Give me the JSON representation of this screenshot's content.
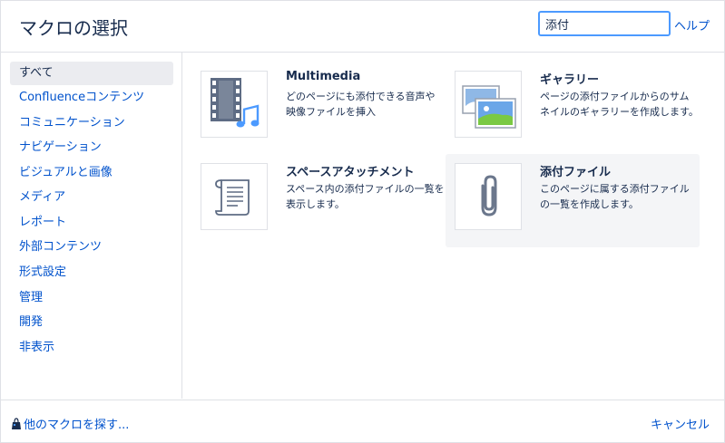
{
  "dialog": {
    "title": "マクロの選択"
  },
  "search": {
    "value": "添付"
  },
  "header": {
    "help_label": "ヘルプ"
  },
  "sidebar": {
    "items": [
      {
        "label": "すべて",
        "active": true
      },
      {
        "label": "Confluenceコンテンツ"
      },
      {
        "label": "コミュニケーション"
      },
      {
        "label": "ナビゲーション"
      },
      {
        "label": "ビジュアルと画像"
      },
      {
        "label": "メディア"
      },
      {
        "label": "レポート"
      },
      {
        "label": "外部コンテンツ"
      },
      {
        "label": "形式設定"
      },
      {
        "label": "管理"
      },
      {
        "label": "開発"
      },
      {
        "label": "非表示"
      }
    ]
  },
  "macros": [
    {
      "title": "Multimedia",
      "description": "どのページにも添付できる音声や映像ファイルを挿入",
      "icon": "multimedia-icon"
    },
    {
      "title": "ギャラリー",
      "description": "ページの添付ファイルからのサムネイルのギャラリーを作成します。",
      "icon": "gallery-icon"
    },
    {
      "title": "スペースアタッチメント",
      "description": "スペース内の添付ファイルの一覧を表示します。",
      "icon": "scroll-icon"
    },
    {
      "title": "添付ファイル",
      "description": "このページに属する添付ファイルの一覧を作成します。",
      "icon": "paperclip-icon",
      "active": true
    }
  ],
  "footer": {
    "find_more_label": "他のマクロを探す...",
    "cancel_label": "キャンセル"
  },
  "colors": {
    "accent": "#0052cc",
    "focus_border": "#4c9aff",
    "selected_bg": "#ebecf0"
  }
}
